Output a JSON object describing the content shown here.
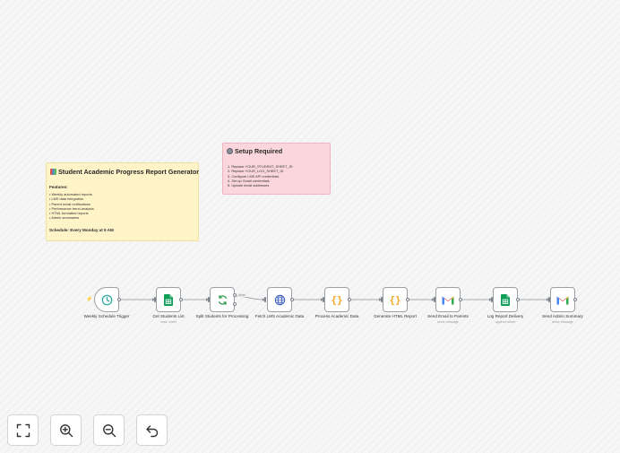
{
  "notes": {
    "main": {
      "title": "Student Academic Progress Report Generator",
      "features_heading": "Features:",
      "features": [
        "• Weekly automated reports",
        "• LMS data integration",
        "• Parent email notifications",
        "• Performance trend analysis",
        "• HTML formatted reports",
        "• Admin summaries"
      ],
      "schedule": "Schedule: Every Monday at 9 AM"
    },
    "setup": {
      "title": "Setup Required",
      "steps": [
        "1. Replace YOUR_STUDENT_SHEET_ID",
        "2. Replace YOUR_LOG_SHEET_ID",
        "3. Configure LMS API credentials",
        "4. Set up Gmail credentials",
        "5. Update email addresses"
      ]
    }
  },
  "nodes": [
    {
      "label": "Weekly Schedule Trigger",
      "sub": "",
      "icon": "clock-icon",
      "color": "#26a69a"
    },
    {
      "label": "Get Students List",
      "sub": "read: sheet",
      "icon": "google-sheets-icon",
      "color": "#0f9d58"
    },
    {
      "label": "Split Students for Processing",
      "sub": "",
      "icon": "loop-icon",
      "color": "#2e9a4a"
    },
    {
      "label": "Fetch LMS Academic Data",
      "sub": "",
      "icon": "globe-icon",
      "color": "#3f5fbf"
    },
    {
      "label": "Process Academic Data",
      "sub": "",
      "icon": "code-icon",
      "color": "#f5a623"
    },
    {
      "label": "Generate HTML Report",
      "sub": "",
      "icon": "code-icon",
      "color": "#f5a623"
    },
    {
      "label": "Send Email to Parents",
      "sub": "send: message",
      "icon": "gmail-icon",
      "color": "#ea4335"
    },
    {
      "label": "Log Report Delivery",
      "sub": "append: sheet",
      "icon": "google-sheets-icon",
      "color": "#0f9d58"
    },
    {
      "label": "Send Admin Summary",
      "sub": "send: message",
      "icon": "gmail-icon",
      "color": "#ea4335"
    }
  ],
  "connection_labels": {
    "split_done": "done"
  },
  "toolbar": [
    {
      "name": "fit-view-button",
      "icon": "fullscreen-icon"
    },
    {
      "name": "zoom-in-button",
      "icon": "zoom-in-icon"
    },
    {
      "name": "zoom-out-button",
      "icon": "zoom-out-icon"
    },
    {
      "name": "undo-button",
      "icon": "undo-icon"
    }
  ],
  "colors": {
    "node_border": "#9aa0a6",
    "trigger_accent": "#ff6d5a",
    "note_yellow": "#fff3c8",
    "note_pink": "#fbd7dd"
  }
}
